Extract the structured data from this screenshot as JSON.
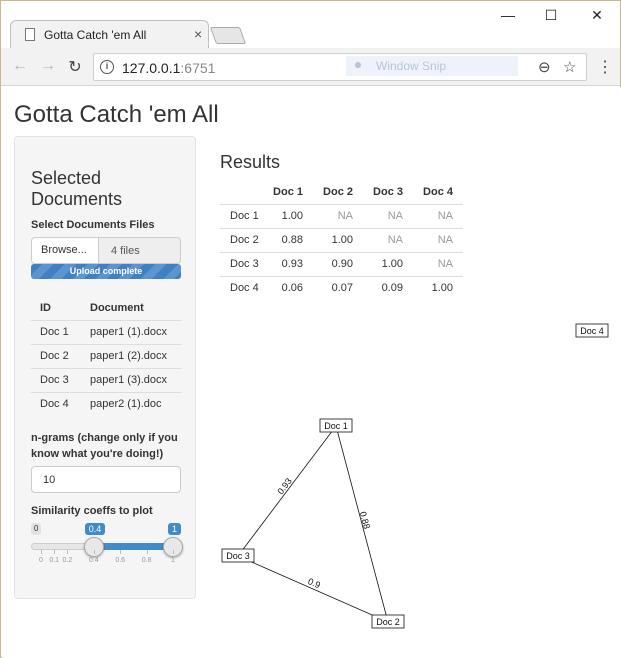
{
  "browser": {
    "tab_title": "Gotta Catch 'em All",
    "tab_close": "×",
    "url_host": "127.0.0.1",
    "url_port": ":6751",
    "snip_label": "Window Snip",
    "controls": {
      "minimize": "—",
      "maximize": "☐",
      "close": "✕"
    },
    "nav": {
      "back": "←",
      "forward": "→",
      "reload": "↻"
    },
    "zoom_icon": "⊖",
    "star_icon": "☆",
    "menu_icon": "⋮",
    "info_icon": "i"
  },
  "app": {
    "title": "Gotta Catch 'em All"
  },
  "sidebar": {
    "heading": "Selected Documents",
    "files_label": "Select Documents Files",
    "browse_label": "Browse...",
    "files_value": "4 files",
    "progress_text": "Upload complete",
    "table": {
      "headers": [
        "ID",
        "Document"
      ],
      "rows": [
        [
          "Doc 1",
          "paper1 (1).docx"
        ],
        [
          "Doc 2",
          "paper1 (2).docx"
        ],
        [
          "Doc 3",
          "paper1 (3).docx"
        ],
        [
          "Doc 4",
          "paper2 (1).doc"
        ]
      ]
    },
    "ngram_label": "n-grams (change only if you know what you're doing!)",
    "ngram_value": "10",
    "slider_label": "Similarity coeffs to plot",
    "slider": {
      "min_label": "0",
      "low_value": "0.4",
      "high_value": "1",
      "low": 0.4,
      "high": 1,
      "ticks": [
        "0",
        "0.1",
        "0.2",
        "0.4",
        "0.6",
        "0.8",
        "1"
      ]
    }
  },
  "results": {
    "title": "Results",
    "headers": [
      "",
      "Doc 1",
      "Doc 2",
      "Doc 3",
      "Doc 4"
    ],
    "rows": [
      [
        "Doc 1",
        "1.00",
        "NA",
        "NA",
        "NA"
      ],
      [
        "Doc 2",
        "0.88",
        "1.00",
        "NA",
        "NA"
      ],
      [
        "Doc 3",
        "0.93",
        "0.90",
        "1.00",
        "NA"
      ],
      [
        "Doc 4",
        "0.06",
        "0.07",
        "0.09",
        "1.00"
      ]
    ]
  },
  "graph": {
    "nodes": [
      "Doc 1",
      "Doc 2",
      "Doc 3",
      "Doc 4"
    ],
    "edges": [
      {
        "from": "Doc 1",
        "to": "Doc 3",
        "label": "0.93"
      },
      {
        "from": "Doc 1",
        "to": "Doc 2",
        "label": "0.88"
      },
      {
        "from": "Doc 3",
        "to": "Doc 2",
        "label": "0.9"
      }
    ]
  }
}
